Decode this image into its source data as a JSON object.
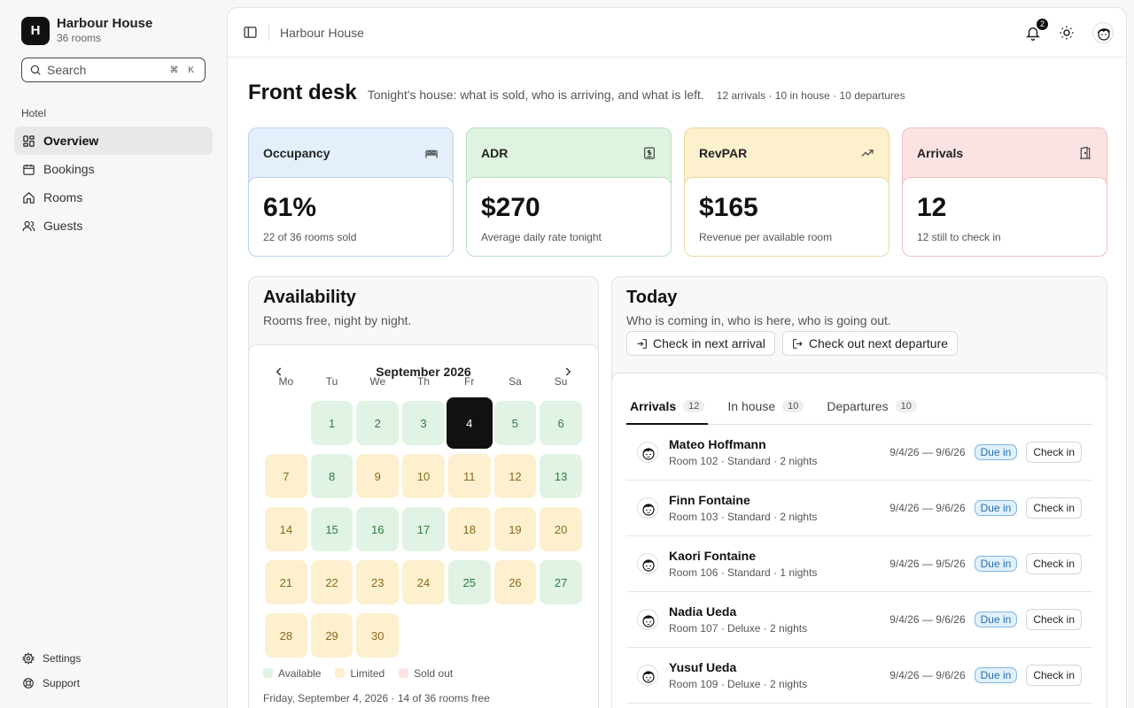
{
  "sidebar": {
    "brand": {
      "initial": "H",
      "name": "Harbour House",
      "sub": "36 rooms"
    },
    "search": {
      "placeholder": "Search",
      "shortcut": "⌘ K"
    },
    "group_label": "Hotel",
    "items": [
      {
        "label": "Overview",
        "icon": "grid-icon",
        "active": true
      },
      {
        "label": "Bookings",
        "icon": "calendar-icon"
      },
      {
        "label": "Rooms",
        "icon": "home-icon"
      },
      {
        "label": "Guests",
        "icon": "users-icon"
      }
    ],
    "bottom": [
      {
        "label": "Settings",
        "icon": "gear-icon"
      },
      {
        "label": "Support",
        "icon": "lifebuoy-icon"
      }
    ]
  },
  "topbar": {
    "breadcrumb": "Harbour House",
    "notifications": "2"
  },
  "page": {
    "title": "Front desk",
    "description": "Tonight's house: what is sold, who is arriving, and what is left.",
    "meta": "12 arrivals · 10 in house · 10 departures"
  },
  "kpis": [
    {
      "title": "Occupancy",
      "value": "61%",
      "sub": "22 of 36 rooms sold",
      "icon": "bed-icon",
      "color": "#e3effb"
    },
    {
      "title": "ADR",
      "value": "$270",
      "sub": "Average daily rate tonight",
      "icon": "receipt-icon",
      "color": "#def4e1"
    },
    {
      "title": "RevPAR",
      "value": "$165",
      "sub": "Revenue per available room",
      "icon": "trending-up-icon",
      "color": "#fcf0cd"
    },
    {
      "title": "Arrivals",
      "value": "12",
      "sub": "12 still to check in",
      "icon": "door-icon",
      "color": "#fce3e3"
    }
  ],
  "availability": {
    "title": "Availability",
    "subtitle": "Rooms free, night by night.",
    "month": "September 2026",
    "weekdays": [
      "Mo",
      "Tu",
      "We",
      "Th",
      "Fr",
      "Sa",
      "Su"
    ],
    "days": [
      {
        "d": "1",
        "s": "available"
      },
      {
        "d": "2",
        "s": "available"
      },
      {
        "d": "3",
        "s": "available"
      },
      {
        "d": "4",
        "s": "selected"
      },
      {
        "d": "5",
        "s": "available"
      },
      {
        "d": "6",
        "s": "available"
      },
      {
        "d": "7",
        "s": "limited"
      },
      {
        "d": "8",
        "s": "available"
      },
      {
        "d": "9",
        "s": "limited"
      },
      {
        "d": "10",
        "s": "limited"
      },
      {
        "d": "11",
        "s": "limited"
      },
      {
        "d": "12",
        "s": "limited"
      },
      {
        "d": "13",
        "s": "available"
      },
      {
        "d": "14",
        "s": "limited"
      },
      {
        "d": "15",
        "s": "available"
      },
      {
        "d": "16",
        "s": "available"
      },
      {
        "d": "17",
        "s": "available"
      },
      {
        "d": "18",
        "s": "limited"
      },
      {
        "d": "19",
        "s": "limited"
      },
      {
        "d": "20",
        "s": "limited"
      },
      {
        "d": "21",
        "s": "limited"
      },
      {
        "d": "22",
        "s": "limited"
      },
      {
        "d": "23",
        "s": "limited"
      },
      {
        "d": "24",
        "s": "limited"
      },
      {
        "d": "25",
        "s": "available"
      },
      {
        "d": "26",
        "s": "limited"
      },
      {
        "d": "27",
        "s": "available"
      },
      {
        "d": "28",
        "s": "limited"
      },
      {
        "d": "29",
        "s": "limited"
      },
      {
        "d": "30",
        "s": "limited"
      }
    ],
    "legend": [
      {
        "label": "Available",
        "color": "#e0f3e4"
      },
      {
        "label": "Limited",
        "color": "#fdf0cf"
      },
      {
        "label": "Sold out",
        "color": "#fce3e3"
      }
    ],
    "footer": "Friday, September 4, 2026 · 14 of 36 rooms free"
  },
  "today": {
    "title": "Today",
    "subtitle": "Who is coming in, who is here, who is going out.",
    "actions": [
      "Check in next arrival",
      "Check out next departure"
    ],
    "tabs": [
      {
        "label": "Arrivals",
        "count": "12",
        "active": true
      },
      {
        "label": "In house",
        "count": "10"
      },
      {
        "label": "Departures",
        "count": "10"
      }
    ],
    "rows": [
      {
        "name": "Mateo Hoffmann",
        "room": "Room 102 · Standard · 2 nights",
        "dates": "9/4/26 — 9/6/26",
        "status": "Due in",
        "action": "Check in"
      },
      {
        "name": "Finn Fontaine",
        "room": "Room 103 · Standard · 2 nights",
        "dates": "9/4/26 — 9/6/26",
        "status": "Due in",
        "action": "Check in"
      },
      {
        "name": "Kaori Fontaine",
        "room": "Room 106 · Standard · 1 nights",
        "dates": "9/4/26 — 9/5/26",
        "status": "Due in",
        "action": "Check in"
      },
      {
        "name": "Nadia Ueda",
        "room": "Room 107 · Deluxe · 2 nights",
        "dates": "9/4/26 — 9/6/26",
        "status": "Due in",
        "action": "Check in"
      },
      {
        "name": "Yusuf Ueda",
        "room": "Room 109 · Deluxe · 2 nights",
        "dates": "9/4/26 — 9/6/26",
        "status": "Due in",
        "action": "Check in"
      }
    ]
  }
}
